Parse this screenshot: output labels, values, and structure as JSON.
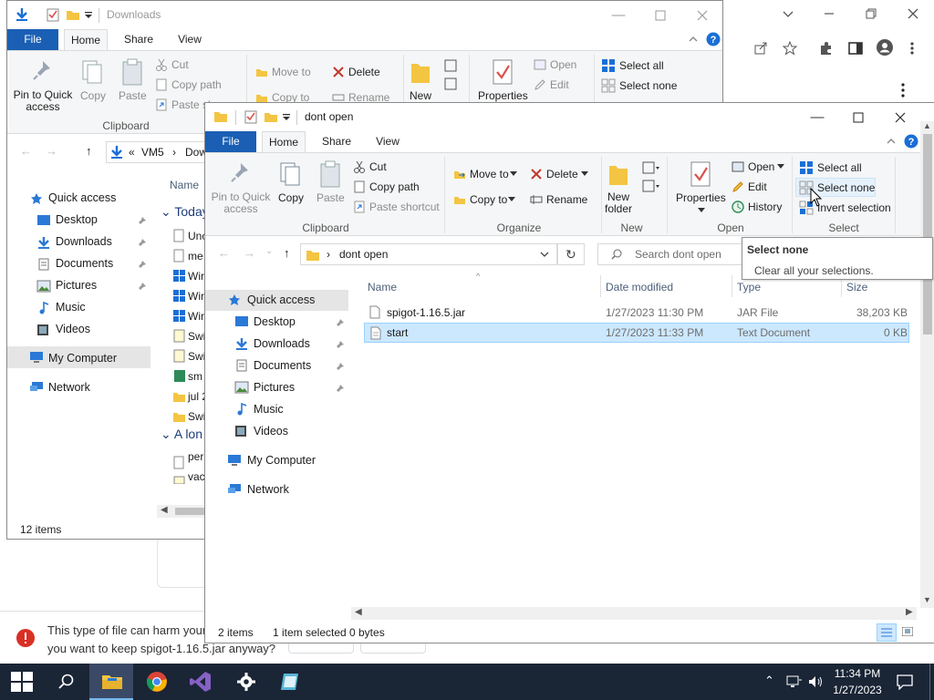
{
  "colors": {
    "accent": "#1a5fb4",
    "taskbar": "#1a2536",
    "selection": "#cce8ff",
    "folder": "#f4c542"
  },
  "browser": {
    "warning_line1": "This type of file can harm your",
    "warning_line2": "you want to keep spigot-1.16.5.jar anyway?",
    "icons": [
      "share-icon",
      "star-icon",
      "extensions-icon",
      "sidepanel-icon",
      "profile-icon",
      "menu-kebab-icon"
    ]
  },
  "back_window": {
    "title": "Downloads",
    "tabs": {
      "file": "File",
      "home": "Home",
      "share": "Share",
      "view": "View"
    },
    "ribbon": {
      "pin": "Pin to Quick access",
      "copy": "Copy",
      "paste": "Paste",
      "cut": "Cut",
      "copy_path": "Copy path",
      "paste_shortcut": "Paste sh...",
      "clipboard": "Clipboard",
      "move_to": "Move to",
      "delete": "Delete",
      "copy_to": "Copy to",
      "rename": "Rename",
      "new_folder": "New",
      "properties": "Properties",
      "open": "Open",
      "edit": "Edit",
      "select_all": "Select all",
      "select_none": "Select none"
    },
    "address": {
      "vm": "VM5",
      "path": "Dow"
    },
    "sidebar": [
      "Quick access",
      "Desktop",
      "Downloads",
      "Documents",
      "Pictures",
      "Music",
      "Videos",
      "My Computer",
      "Network"
    ],
    "column_name": "Name",
    "group_today": "Today",
    "group_long": "A lon",
    "files": [
      "Unc",
      "me",
      "Wir",
      "Wir",
      "Wir",
      "Swi",
      "Swi",
      "sm",
      "jul 2",
      "Swi",
      "per",
      "vac"
    ],
    "status": "12 items"
  },
  "front_window": {
    "title": "dont open",
    "tabs": {
      "file": "File",
      "home": "Home",
      "share": "Share",
      "view": "View"
    },
    "ribbon": {
      "pin": "Pin to Quick access",
      "copy": "Copy",
      "paste": "Paste",
      "cut": "Cut",
      "copy_path": "Copy path",
      "paste_shortcut": "Paste shortcut",
      "clipboard": "Clipboard",
      "move_to": "Move to",
      "copy_to": "Copy to",
      "delete": "Delete",
      "rename": "Rename",
      "organize": "Organize",
      "new_folder": "New folder",
      "new": "New",
      "properties": "Properties",
      "open": "Open",
      "edit": "Edit",
      "history": "History",
      "open_group": "Open",
      "select_all": "Select all",
      "select_none": "Select none",
      "invert_selection": "Invert selection",
      "select_group": "Select"
    },
    "address": {
      "path": "dont open",
      "search_placeholder": "Search dont open"
    },
    "sidebar": [
      "Quick access",
      "Desktop",
      "Downloads",
      "Documents",
      "Pictures",
      "Music",
      "Videos",
      "My Computer",
      "Network"
    ],
    "columns": {
      "name": "Name",
      "date": "Date modified",
      "type": "Type",
      "size": "Size"
    },
    "files": [
      {
        "name": "spigot-1.16.5.jar",
        "date": "1/27/2023 11:30 PM",
        "type": "JAR File",
        "size": "38,203 KB"
      },
      {
        "name": "start",
        "date": "1/27/2023 11:33 PM",
        "type": "Text Document",
        "size": "0 KB"
      }
    ],
    "status": {
      "items": "2 items",
      "selected": "1 item selected",
      "bytes": "0 bytes"
    },
    "tooltip": {
      "title": "Select none",
      "text": "Clear all your selections."
    }
  },
  "taskbar": {
    "time": "11:34 PM",
    "date": "1/27/2023",
    "apps": [
      "start-button",
      "search-icon",
      "file-explorer-icon",
      "chrome-icon",
      "visual-studio-icon",
      "settings-gear-icon",
      "notepad-icon"
    ]
  }
}
